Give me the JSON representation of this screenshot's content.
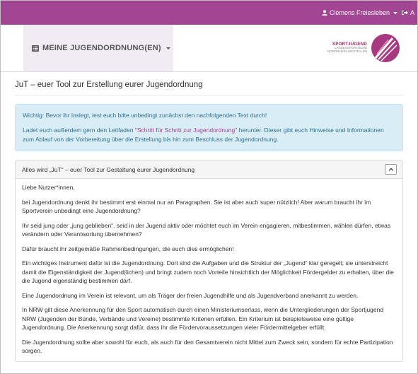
{
  "topbar": {
    "user_name": "Clemens Freiesleben",
    "logout_label": "A"
  },
  "header": {
    "menu_label": "MEINE JUGENDORDNUNG(EN)",
    "logo_line1": "SPORTJUGEND",
    "logo_line2": "LANDESSPORTBUND",
    "logo_line3": "NORDRHEIN-WESTFALEN"
  },
  "page_title": "JuT – euer Tool zur Erstellung eurer Jugendordnung",
  "alert": {
    "line1": "Wichtig: Bevor ihr loslegt, lest euch bitte unbedingt zunächst den nachfolgenden Text durch!",
    "line2_prefix": "Ladet euch außerdem gern den Leitfaden ",
    "line2_link": "\"Schritt für Schritt zur Jugendordnung\"",
    "line2_suffix": " herunter. Dieser gibt euch Hinweise und Informationen zum Ablauf von der Vorbereitung über die Erstellung bis hin zum Beschluss der Jugendordnung."
  },
  "panel": {
    "title": "Alles wird „JuT“ – euer Tool zur Gestaltung eurer Jugendordnung",
    "paragraphs": [
      "Liebe Nutzer*innen,",
      "bei Jugendordnung denkt ihr bestimmt erst einmal nur an Paragraphen. Sie ist aber auch super nützlich! Aber warum braucht ihr im Sportverein unbedingt eine Jugendordnung?",
      "Ihr seid jung oder „jung geblieben“, seid in der Jugend aktiv oder möchtet euch im Verein engagieren, mitbestimmen, wählen dürfen, etwas verändern oder Verantwortung übernehmen?",
      "Dafür braucht ihr zeitgemäße Rahmenbedingungen, die euch dies ermöglichen!",
      "Ein wichtiges Instrument dafür ist die Jugendordnung. Dort sind die Aufgaben und die Struktur der „Jugend“ klar geregelt; sie unterstreicht damit die Eigenständigkeit der Jugend(lichen) und bringt zudem noch Vorteile hinsichtlich der Möglichkeit Fördergelder zu erhalten, über die die Jugend eigenständig bestimmen darf.",
      "Eine Jugendordnung im Verein ist relevant, um als Träger der freien Jugendhilfe und als Jugendverband anerkannt zu werden.",
      "In NRW gilt diese Anerkennung für den Sport automatisch durch einen Ministeriumserlass, wenn die Untergliederungen der Sportjugend NRW (Jugenden der Bünde, Verbände und Vereine) bestimmte Kriterien erfüllen. Ein Kriterium ist beispielsweise eine gültige Jugendordnung. Die Anerkennung sorgt dafür, dass ihr die Fördervoraussetzungen vieler Fördermittelgeber erfüllt.",
      "Die Jugendordnung sollte aber sowohl für euch, als auch für den Gesamtverein nicht Mittel zum Zweck sein, sondern für echte Partizipation sorgen."
    ]
  }
}
